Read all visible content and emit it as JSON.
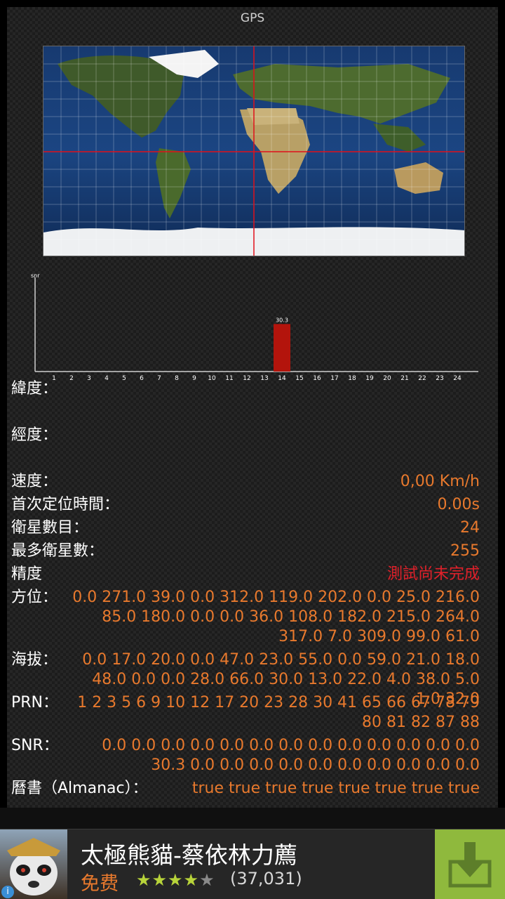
{
  "app": {
    "title": "GPS"
  },
  "colors": {
    "accent": "#e8792d",
    "alert": "#e0202a",
    "bar": "#b3140c",
    "crosshair": "#e0101a"
  },
  "chart_data": {
    "type": "bar",
    "ylabel": "snr",
    "categories": [
      "1",
      "2",
      "3",
      "4",
      "5",
      "6",
      "7",
      "8",
      "9",
      "10",
      "11",
      "12",
      "13",
      "14",
      "15",
      "16",
      "17",
      "18",
      "19",
      "20",
      "21",
      "22",
      "23",
      "24"
    ],
    "values": [
      0,
      0,
      0,
      0,
      0,
      0,
      0,
      0,
      0,
      0,
      0,
      0,
      0,
      30.3,
      0,
      0,
      0,
      0,
      0,
      0,
      0,
      0,
      0,
      0
    ],
    "data_labels": {
      "14": "30.3"
    }
  },
  "info": {
    "latitude_label": "緯度：",
    "longitude_label": "經度：",
    "speed_label": "速度：",
    "speed_value": "0,00 Km/h",
    "ttff_label": "首次定位時間：",
    "ttff_value": "0.00s",
    "sat_count_label": "衛星數目：",
    "sat_count_value": "24",
    "max_sat_label": "最多衛星數：",
    "max_sat_value": "255",
    "accuracy_label": "精度",
    "accuracy_value": "測試尚未完成",
    "azimuth_label": "方位：",
    "azimuth_value": "0.0 271.0 39.0 0.0 312.0 119.0 202.0 0.0 25.0 216.0 85.0 180.0 0.0 0.0 36.0 108.0 182.0 215.0 264.0 317.0 7.0 309.0 99.0 61.0",
    "elevation_label": "海拔：",
    "elevation_value": "0.0 17.0 20.0 0.0 47.0 23.0 55.0 0.0 59.0 21.0 18.0 48.0 0.0 0.0 28.0 66.0 30.0 13.0 22.0 4.0 38.0 5.0 1.0 32.0",
    "prn_label": "PRN：",
    "prn_value": "1 2 3 5 6 9 10 12 17 20 23 28 30 41 65 66 67 78 79 80 81 82 87 88",
    "snr_label": "SNR：",
    "snr_value": "0.0 0.0 0.0 0.0 0.0 0.0 0.0 0.0 0.0 0.0 0.0 0.0 0.0 30.3 0.0 0.0 0.0 0.0 0.0 0.0 0.0 0.0 0.0 0.0",
    "almanac_label": "曆書（Almanac）：",
    "almanac_value": "true true true true true true true true"
  },
  "ad": {
    "title": "太極熊貓-蔡依林力薦",
    "price": "免费",
    "stars_full": "★★★★",
    "stars_empty": "★",
    "rating_count": "(37,031)",
    "info_glyph": "i",
    "download_icon": "download-icon"
  }
}
